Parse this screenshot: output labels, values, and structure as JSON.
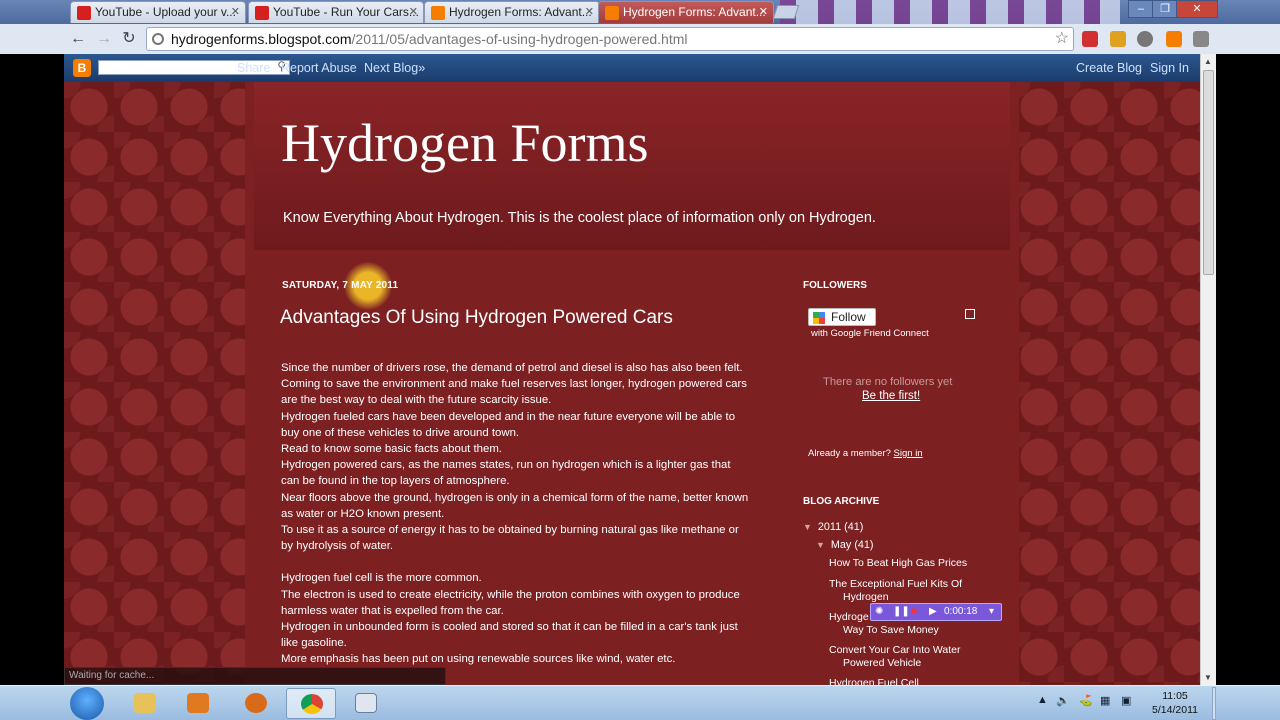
{
  "browser": {
    "tabs": [
      {
        "label": "YouTube - Upload your v...",
        "favicon": "youtube-icon"
      },
      {
        "label": "YouTube - Run Your Cars...",
        "favicon": "youtube-icon"
      },
      {
        "label": "Hydrogen Forms: Advant...",
        "favicon": "blogger-icon"
      },
      {
        "label": "Hydrogen Forms: Advant...",
        "favicon": "blogger-icon",
        "active": true
      }
    ],
    "url_host": "hydrogenforms.blogspot.com",
    "url_path": "/2011/05/advantages-of-using-hydrogen-powered.html",
    "status_text": "Waiting for cache..."
  },
  "navbar": {
    "share": "Share",
    "report_abuse": "Report Abuse",
    "next_blog": "Next Blog»",
    "create_blog": "Create Blog",
    "sign_in": "Sign In"
  },
  "blog": {
    "title": "Hydrogen Forms",
    "description": "Know Everything About Hydrogen. This is the coolest place of information only on Hydrogen."
  },
  "post": {
    "date": "SATURDAY, 7 MAY 2011",
    "title": "Advantages Of Using Hydrogen Powered Cars",
    "paragraphs": [
      "Since the number of drivers rose, the demand of petrol and diesel is also has also been felt.",
      "Coming to save the environment and make fuel reserves last longer, hydrogen powered cars are the best way to deal with the future scarcity issue.",
      "Hydrogen fueled cars have been developed and in the near future everyone will be able to buy one of these vehicles to drive around town.",
      "Read to know some basic facts about them.",
      "Hydrogen powered cars, as the names states, run on hydrogen which is a lighter gas that can be found in the top layers of atmosphere.",
      "Near floors above the ground, hydrogen is only in a chemical form of the name, better known as water or H2O known present.",
      "To use it as a source of energy it has to be obtained by burning natural gas like methane or by hydrolysis of water.",
      "",
      "Hydrogen fuel cell is the more common.",
      "The electron is used to create electricity, while the proton combines with oxygen to produce harmless water that is expelled from the car.",
      "Hydrogen in unbounded form is cooled and stored so that it can be filled in a car's tank just like gasoline.",
      "More emphasis has been put on using renewable sources like wind, water etc."
    ]
  },
  "sidebar": {
    "followers_heading": "FOLLOWERS",
    "follow_button": "Follow",
    "gfc_text": "with Google Friend Connect",
    "no_followers": "There are no followers yet",
    "be_first": "Be the first!",
    "already_member": "Already a member?",
    "sign_in_link": "Sign in",
    "archive_heading": "BLOG ARCHIVE",
    "year": "2011 (41)",
    "month": "May (41)",
    "archive_posts": [
      {
        "line1": "How To Beat High Gas Prices",
        "line2": ""
      },
      {
        "line1": "The Exceptional Fuel Kits Of",
        "line2": "Hydrogen"
      },
      {
        "line1": "Hydroge",
        "line2": "Way To Save Money"
      },
      {
        "line1": "Convert Your Car Into Water",
        "line2": "Powered Vehicle"
      },
      {
        "line1": "Hydrogen Fuel Cell",
        "line2": ""
      }
    ]
  },
  "recorder": {
    "time": "0:00:18"
  },
  "taskbar": {
    "time": "11:05",
    "date": "5/14/2011"
  }
}
